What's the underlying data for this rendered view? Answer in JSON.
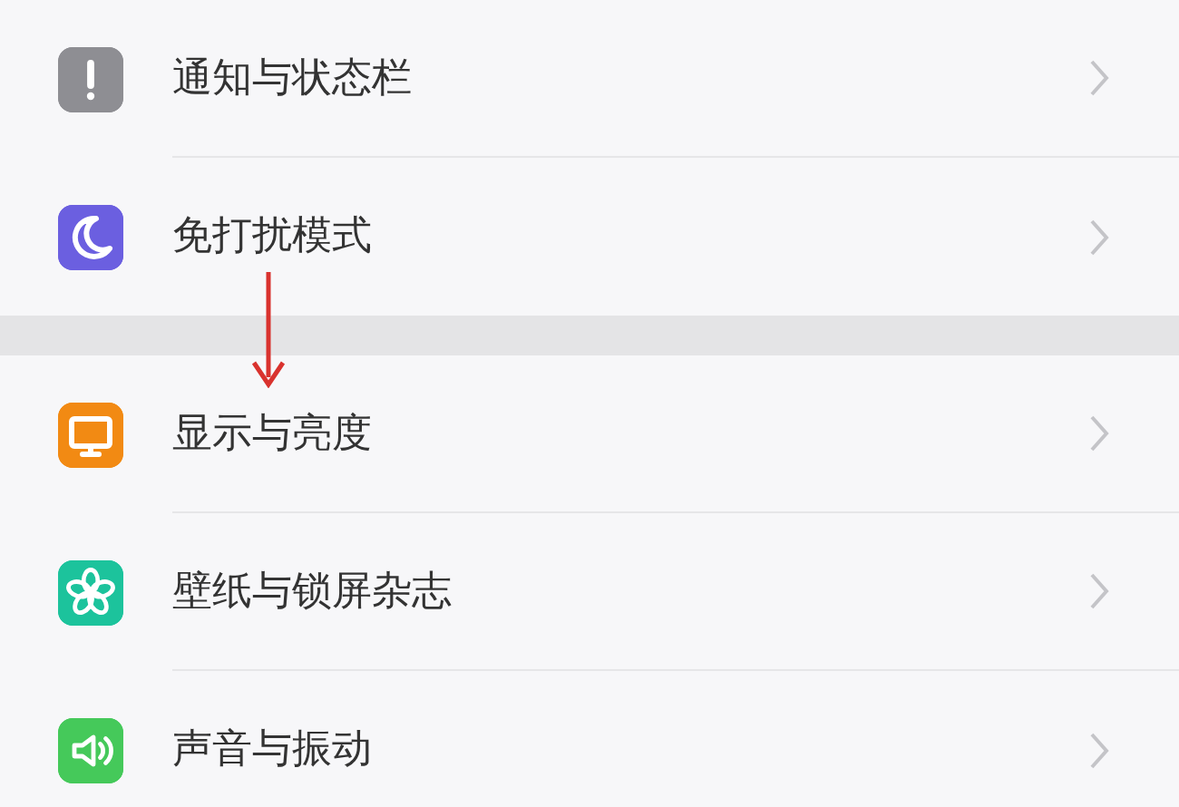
{
  "groups": [
    {
      "items": [
        {
          "label": "通知与状态栏",
          "color": "#8e8e93"
        },
        {
          "label": "免打扰模式",
          "color": "#6b5fe0"
        }
      ]
    },
    {
      "items": [
        {
          "label": "显示与亮度",
          "color": "#f28a13"
        },
        {
          "label": "壁纸与锁屏杂志",
          "color": "#1cc39c"
        },
        {
          "label": "声音与振动",
          "color": "#45c95a"
        }
      ]
    }
  ]
}
